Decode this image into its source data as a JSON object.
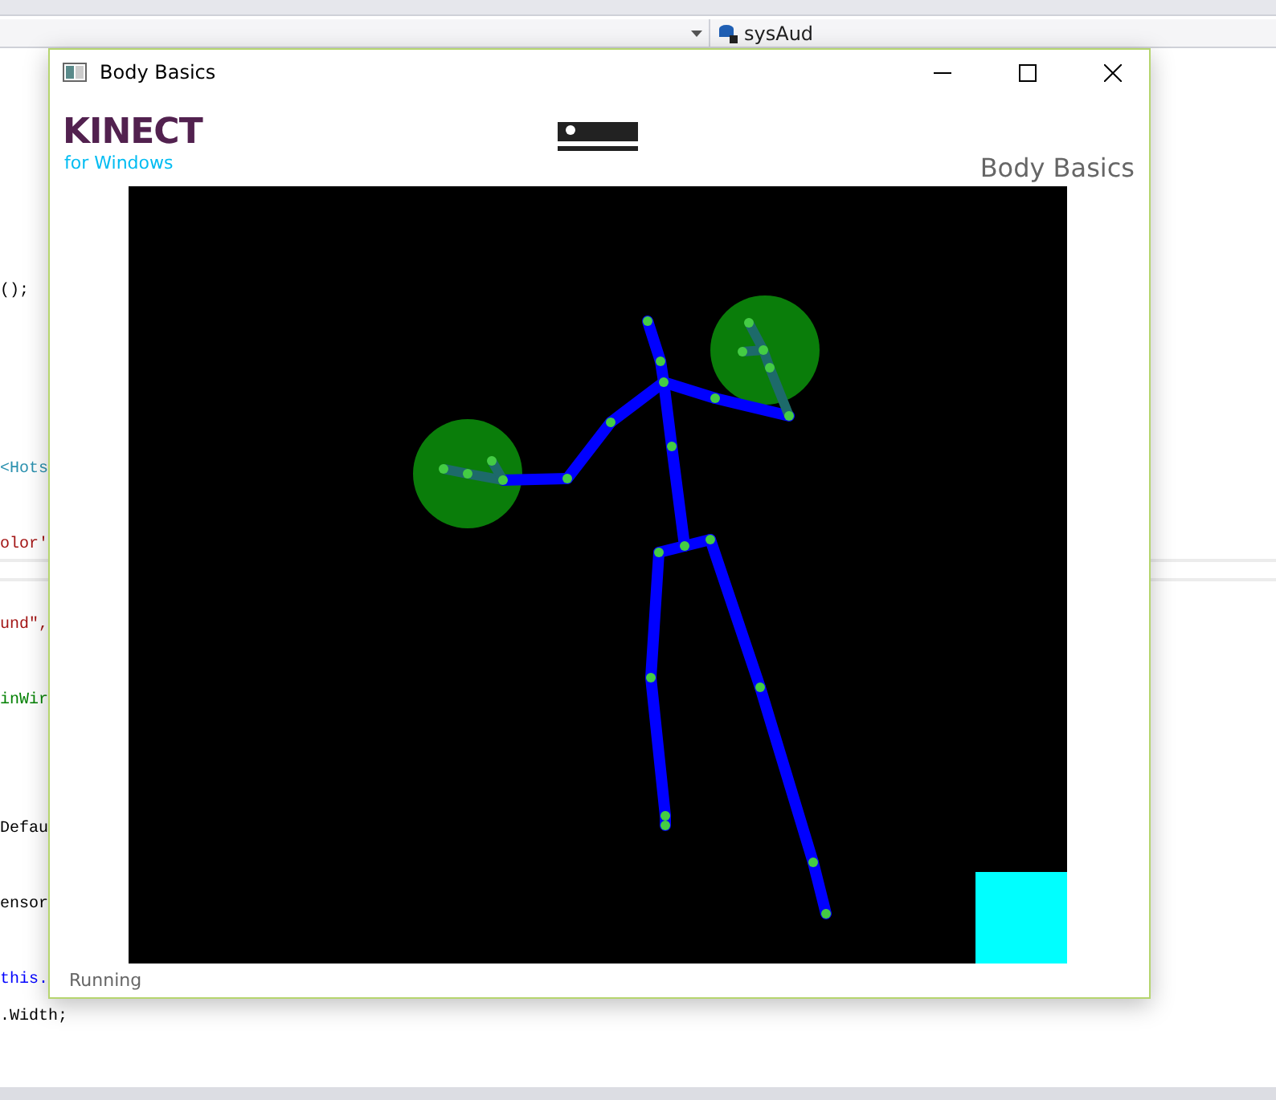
{
  "editor": {
    "dropdown_value": "sysAud",
    "code_lines": [
      {
        "text": "();",
        "kind": "plain"
      },
      {
        "text": "<Hots",
        "kind": "type"
      },
      {
        "text": "olor'",
        "kind": "string"
      },
      {
        "text": "und\",",
        "kind": "string"
      },
      {
        "text": "inWir",
        "kind": "comment"
      },
      {
        "text": "Defau",
        "kind": "plain"
      },
      {
        "text": "ensor",
        "kind": "plain"
      },
      {
        "text": "this.",
        "kind": "keyword"
      },
      {
        "text": ".Width;",
        "kind": "plain"
      }
    ]
  },
  "window": {
    "title": "Body Basics",
    "logo": {
      "brand": "KINECT",
      "sub": "for Windows"
    },
    "app_title": "Body Basics",
    "status": "Running"
  }
}
